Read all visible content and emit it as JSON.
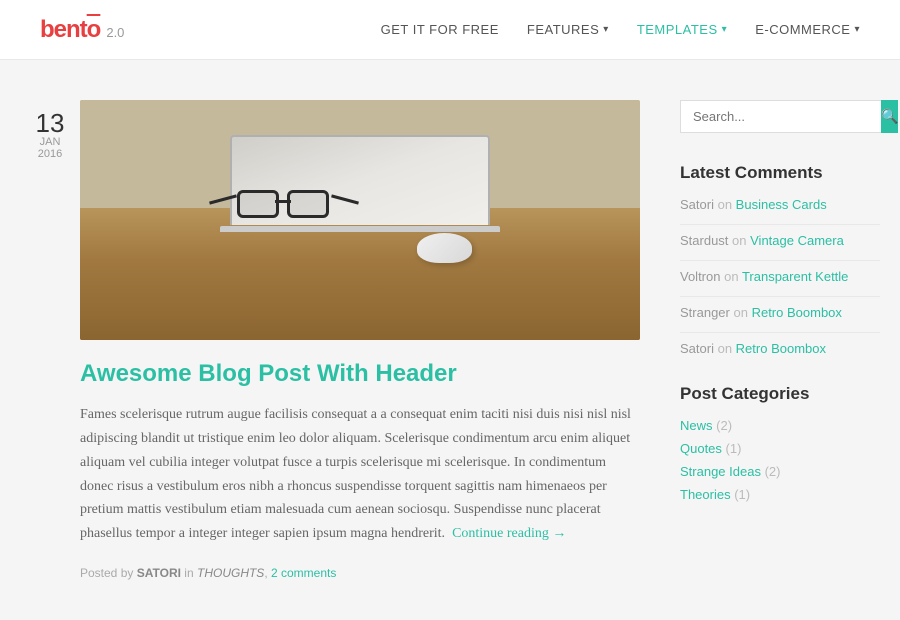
{
  "header": {
    "logo": {
      "text": "bentō",
      "version": "2.0"
    },
    "nav": [
      {
        "label": "GET IT FOR FREE",
        "active": false,
        "hasDropdown": false
      },
      {
        "label": "FEATURES",
        "active": false,
        "hasDropdown": true
      },
      {
        "label": "TEMPLATES",
        "active": true,
        "hasDropdown": true
      },
      {
        "label": "E-COMMERCE",
        "active": false,
        "hasDropdown": true
      }
    ]
  },
  "post": {
    "date": {
      "day": "13",
      "month": "JAN",
      "year": "2016"
    },
    "title": "Awesome Blog Post With Header",
    "body": "Fames scelerisque rutrum augue facilisis consequat a a consequat enim taciti nisi duis nisi nisl nisl adipiscing blandit ut tristique enim leo dolor aliquam. Scelerisque condimentum arcu enim aliquet aliquam vel cubilia integer volutpat fusce a turpis scelerisque mi scelerisque. In condimentum donec risus a vestibulum eros nibh a rhoncus suspendisse torquent sagittis nam himenaeos per pretium mattis vestibulum etiam malesuada cum aenean sociosqu. Suspendisse nunc placerat phasellus tempor a integer integer sapien ipsum magna hendrerit.",
    "read_more": "Continue reading →",
    "footer": {
      "posted_by": "Posted by",
      "author": "SATORI",
      "in": "in",
      "category": "THOUGHTS",
      "comments": "2 comments"
    }
  },
  "sidebar": {
    "search": {
      "placeholder": "Search...",
      "button_icon": "🔍"
    },
    "latest_comments": {
      "heading": "Latest Comments",
      "items": [
        {
          "author": "Satori",
          "on": "on",
          "post": "Business Cards"
        },
        {
          "author": "Stardust",
          "on": "on",
          "post": "Vintage Camera"
        },
        {
          "author": "Voltron",
          "on": "on",
          "post": "Transparent Kettle"
        },
        {
          "author": "Stranger",
          "on": "on",
          "post": "Retro Boombox"
        },
        {
          "author": "Satori",
          "on": "on",
          "post": "Retro Boombox"
        }
      ]
    },
    "post_categories": {
      "heading": "Post Categories",
      "items": [
        {
          "label": "News",
          "count": "(2)"
        },
        {
          "label": "Quotes",
          "count": "(1)"
        },
        {
          "label": "Strange Ideas",
          "count": "(2)"
        },
        {
          "label": "Theories",
          "count": "(1)"
        }
      ]
    }
  }
}
